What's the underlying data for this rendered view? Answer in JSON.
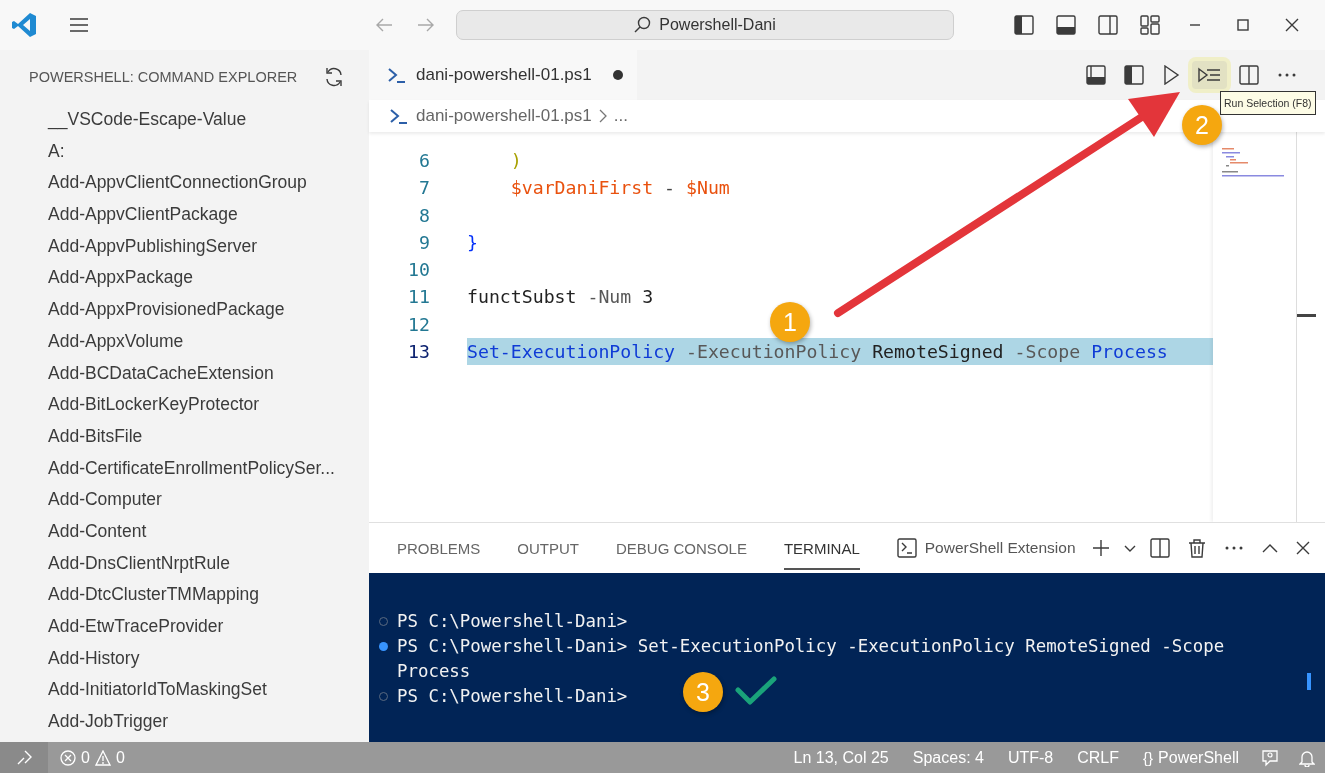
{
  "title_bar": {
    "search": "Powershell-Dani"
  },
  "sidebar": {
    "title": "POWERSHELL: COMMAND EXPLORER",
    "items": [
      {
        "label": "__VSCode-Escape-Value"
      },
      {
        "label": "A:"
      },
      {
        "label": "Add-AppvClientConnectionGroup"
      },
      {
        "label": "Add-AppvClientPackage"
      },
      {
        "label": "Add-AppvPublishingServer"
      },
      {
        "label": "Add-AppxPackage"
      },
      {
        "label": "Add-AppxProvisionedPackage"
      },
      {
        "label": "Add-AppxVolume"
      },
      {
        "label": "Add-BCDataCacheExtension"
      },
      {
        "label": "Add-BitLockerKeyProtector"
      },
      {
        "label": "Add-BitsFile"
      },
      {
        "label": "Add-CertificateEnrollmentPolicySer..."
      },
      {
        "label": "Add-Computer"
      },
      {
        "label": "Add-Content"
      },
      {
        "label": "Add-DnsClientNrptRule"
      },
      {
        "label": "Add-DtcClusterTMMapping"
      },
      {
        "label": "Add-EtwTraceProvider"
      },
      {
        "label": "Add-History"
      },
      {
        "label": "Add-InitiatorIdToMaskingSet"
      },
      {
        "label": "Add-JobTrigger"
      }
    ]
  },
  "editor": {
    "tabs": [
      {
        "label": "dani-powershell-01.ps1",
        "selected": true,
        "modified": true
      }
    ],
    "breadcrumb": [
      "dani-powershell-01.ps1",
      "..."
    ],
    "tooltip": "Run Selection (F8)",
    "lines": [
      {
        "number": "6",
        "selected": false,
        "tokens": [
          {
            "kind": "bracket",
            "text": "    )"
          }
        ]
      },
      {
        "number": "7",
        "selected": false,
        "tokens": [
          {
            "kind": "variable",
            "text": "    $varDaniFirst"
          },
          {
            "kind": "operator",
            "text": " - "
          },
          {
            "kind": "variable",
            "text": "$Num"
          }
        ]
      },
      {
        "number": "8",
        "selected": false
      },
      {
        "number": "9",
        "selected": false,
        "tokens": [
          {
            "kind": "brace",
            "text": "}"
          }
        ]
      },
      {
        "number": "10",
        "selected": false
      },
      {
        "number": "11",
        "selected": false,
        "tokens": [
          {
            "kind": "plain",
            "text": "functSubst"
          },
          {
            "kind": "parameter",
            "text": " -Num"
          },
          {
            "kind": "plain",
            "text": " 3"
          }
        ]
      },
      {
        "number": "12",
        "selected": false
      },
      {
        "number": "13",
        "selected": true,
        "tokens": [
          {
            "kind": "command",
            "text": "Set-ExecutionPolicy"
          },
          {
            "kind": "parameter",
            "text": " -ExecutionPolicy"
          },
          {
            "kind": "plain",
            "text": " RemoteSigned"
          },
          {
            "kind": "parameter",
            "text": " -Scope"
          },
          {
            "kind": "command",
            "text": " Process"
          }
        ]
      }
    ]
  },
  "panel": {
    "tabs": [
      {
        "label": "PROBLEMS",
        "selected": false
      },
      {
        "label": "OUTPUT",
        "selected": false
      },
      {
        "label": "DEBUG CONSOLE",
        "selected": false
      },
      {
        "label": "TERMINAL",
        "selected": true
      }
    ],
    "terminal_name": "PowerShell Extension",
    "terminal_lines": [
      {
        "has_command": false,
        "text": "PS C:\\Powershell-Dani>"
      },
      {
        "has_command": true,
        "text": "PS C:\\Powershell-Dani> Set-ExecutionPolicy -ExecutionPolicy RemoteSigned -Scope Process"
      },
      {
        "has_command": false,
        "text": "PS C:\\Powershell-Dani>"
      }
    ]
  },
  "annotations": [
    {
      "text": "1"
    },
    {
      "text": "2"
    },
    {
      "text": "3"
    }
  ],
  "status_bar": {
    "errors": "0",
    "warnings": "0",
    "items": [
      "Ln 13, Col 25",
      "Spaces: 4",
      "UTF-8",
      "CRLF"
    ],
    "language_icon": "{}",
    "language": "PowerShell"
  }
}
